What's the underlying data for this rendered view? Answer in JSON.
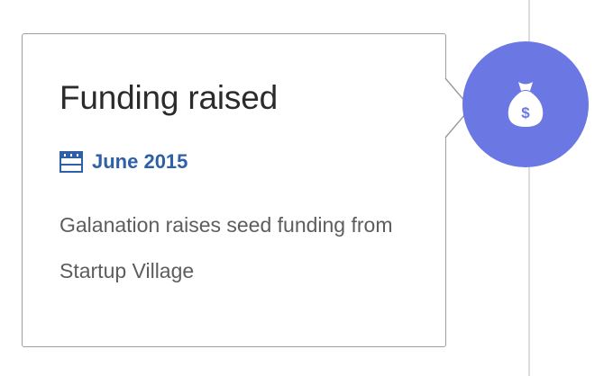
{
  "event": {
    "title": "Funding raised",
    "date": "June 2015",
    "description": "Galanation raises seed funding from Startup Village",
    "icon": "moneybag-icon",
    "date_icon": "calendar-icon"
  },
  "colors": {
    "badge": "#6b77e3",
    "date_text": "#2e5fa7",
    "card_border": "#9e9e9e",
    "timeline_line": "#dcdcdc"
  }
}
